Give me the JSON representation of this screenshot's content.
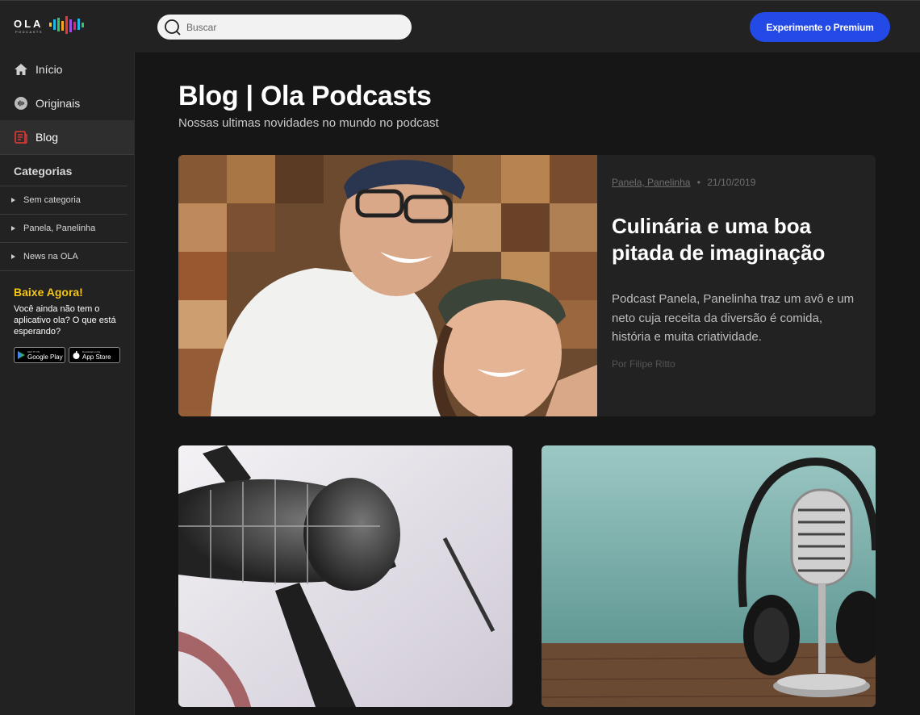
{
  "brand": {
    "logo_text": "OLA",
    "logo_sub": "PODCASTS"
  },
  "search": {
    "placeholder": "Buscar"
  },
  "header": {
    "premium_label": "Experimente o Premium"
  },
  "sidebar": {
    "nav": [
      {
        "label": "Início",
        "icon": "home-icon"
      },
      {
        "label": "Originais",
        "icon": "originals-icon"
      },
      {
        "label": "Blog",
        "icon": "blog-icon",
        "active": true
      }
    ],
    "categories_title": "Categorias",
    "categories": [
      "Sem categoria",
      "Panela, Panelinha",
      "News na OLA"
    ],
    "download": {
      "title": "Baixe Agora!",
      "text": "Você ainda não tem o aplicativo ola? O que está esperando?",
      "google_small": "GET IT ON",
      "google_big": "Google Play",
      "apple_small": "Download on the",
      "apple_big": "App Store"
    }
  },
  "main": {
    "title": "Blog | Ola Podcasts",
    "subtitle": "Nossas ultimas novidades no mundo no podcast",
    "featured": {
      "category": "Panela, Panelinha",
      "date": "21/10/2019",
      "title": "Culinária e uma boa pitada de imaginação",
      "excerpt": "Podcast Panela, Panelinha traz um avô e um neto cuja receita da diversão é comida, história e muita criatividade.",
      "author": "Por Filipe Ritto"
    }
  },
  "colors": {
    "accent": "#2349e6",
    "download_title": "#f5c518",
    "blog_icon": "#e53935"
  }
}
